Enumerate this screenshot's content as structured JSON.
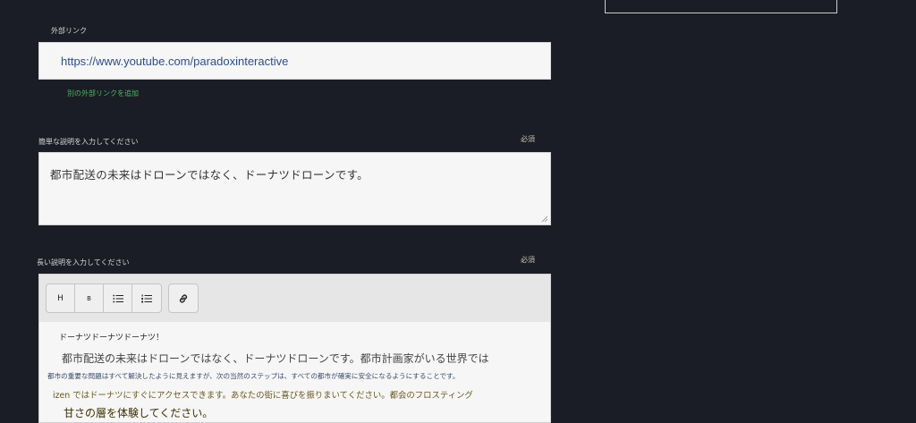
{
  "external_link": {
    "label": "外部リンク",
    "value": "https://www.youtube.com/paradoxinteractive",
    "add_link": "別の外部リンクを追加"
  },
  "short_description": {
    "label": "簡単な説明を入力してください",
    "required": "必須",
    "value": "都市配送の未来はドローンではなく、ドーナツドローンです。"
  },
  "long_description": {
    "label": "長い説明を入力してください",
    "required": "必須",
    "toolbar": {
      "heading": "H",
      "bold": "B",
      "bullet_list_icon": "bullet-list-icon",
      "numbered_list_icon": "numbered-list-icon",
      "link_icon": "link-icon"
    },
    "content": {
      "title": "ドーナツドーナツドーナツ！",
      "line1": "都市配送の未来はドローンではなく、ドーナツドローンです。都市計画家がいる世界では",
      "line2": "都市の重要な問題はすべて解決したように見えますが、次の当然のステップは、すべての都市が確実に安全になるようにすることです。",
      "line3": "izen ではドーナツにすぐにアクセスできます。あなたの街に喜びを振りまいてください。都会のフロスティング",
      "line4": "甘さの層を体験してください。"
    }
  },
  "colors": {
    "background": "#1a1d25",
    "field": "#f6f6f6",
    "link_text": "#2d4e8a",
    "add_link": "#4bb85a"
  }
}
